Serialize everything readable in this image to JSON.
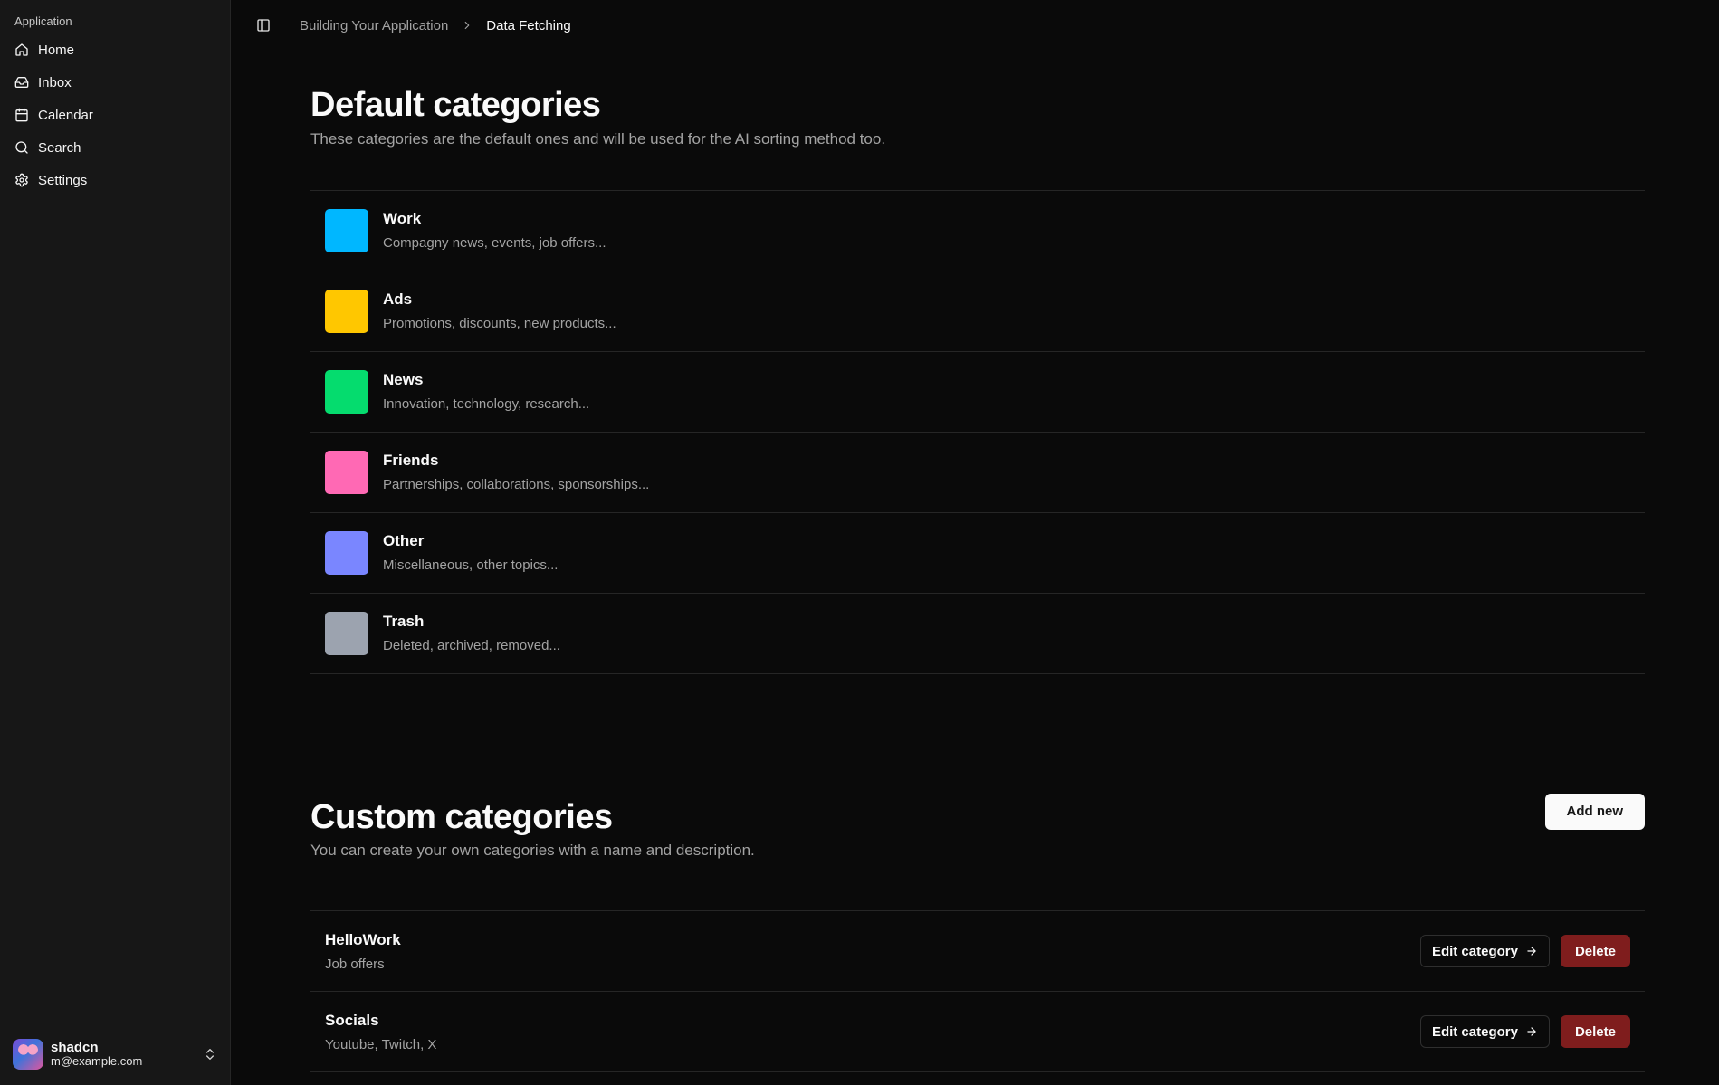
{
  "sidebar": {
    "group_label": "Application",
    "items": [
      {
        "label": "Home",
        "icon": "home-icon"
      },
      {
        "label": "Inbox",
        "icon": "inbox-icon"
      },
      {
        "label": "Calendar",
        "icon": "calendar-icon"
      },
      {
        "label": "Search",
        "icon": "search-icon"
      },
      {
        "label": "Settings",
        "icon": "gear-icon"
      }
    ],
    "user": {
      "name": "shadcn",
      "email": "m@example.com"
    }
  },
  "breadcrumb": {
    "parent": "Building Your Application",
    "current": "Data Fetching"
  },
  "default_section": {
    "title": "Default categories",
    "subtitle": "These categories are the default ones and will be used for the AI sorting method too.",
    "categories": [
      {
        "name": "Work",
        "description": "Compagny news, events, job offers...",
        "color": "#00b7ff"
      },
      {
        "name": "Ads",
        "description": "Promotions, discounts, new products...",
        "color": "#ffc700"
      },
      {
        "name": "News",
        "description": "Innovation, technology, research...",
        "color": "#05dc6e"
      },
      {
        "name": "Friends",
        "description": "Partnerships, collaborations, sponsorships...",
        "color": "#ff69b4"
      },
      {
        "name": "Other",
        "description": "Miscellaneous, other topics...",
        "color": "#7a86ff"
      },
      {
        "name": "Trash",
        "description": "Deleted, archived, removed...",
        "color": "#9ca3af"
      }
    ]
  },
  "custom_section": {
    "title": "Custom categories",
    "subtitle": "You can create your own categories with a name and description.",
    "add_label": "Add new",
    "edit_label": "Edit category",
    "delete_label": "Delete",
    "categories": [
      {
        "name": "HelloWork",
        "description": "Job offers"
      },
      {
        "name": "Socials",
        "description": "Youtube, Twitch, X"
      }
    ]
  }
}
